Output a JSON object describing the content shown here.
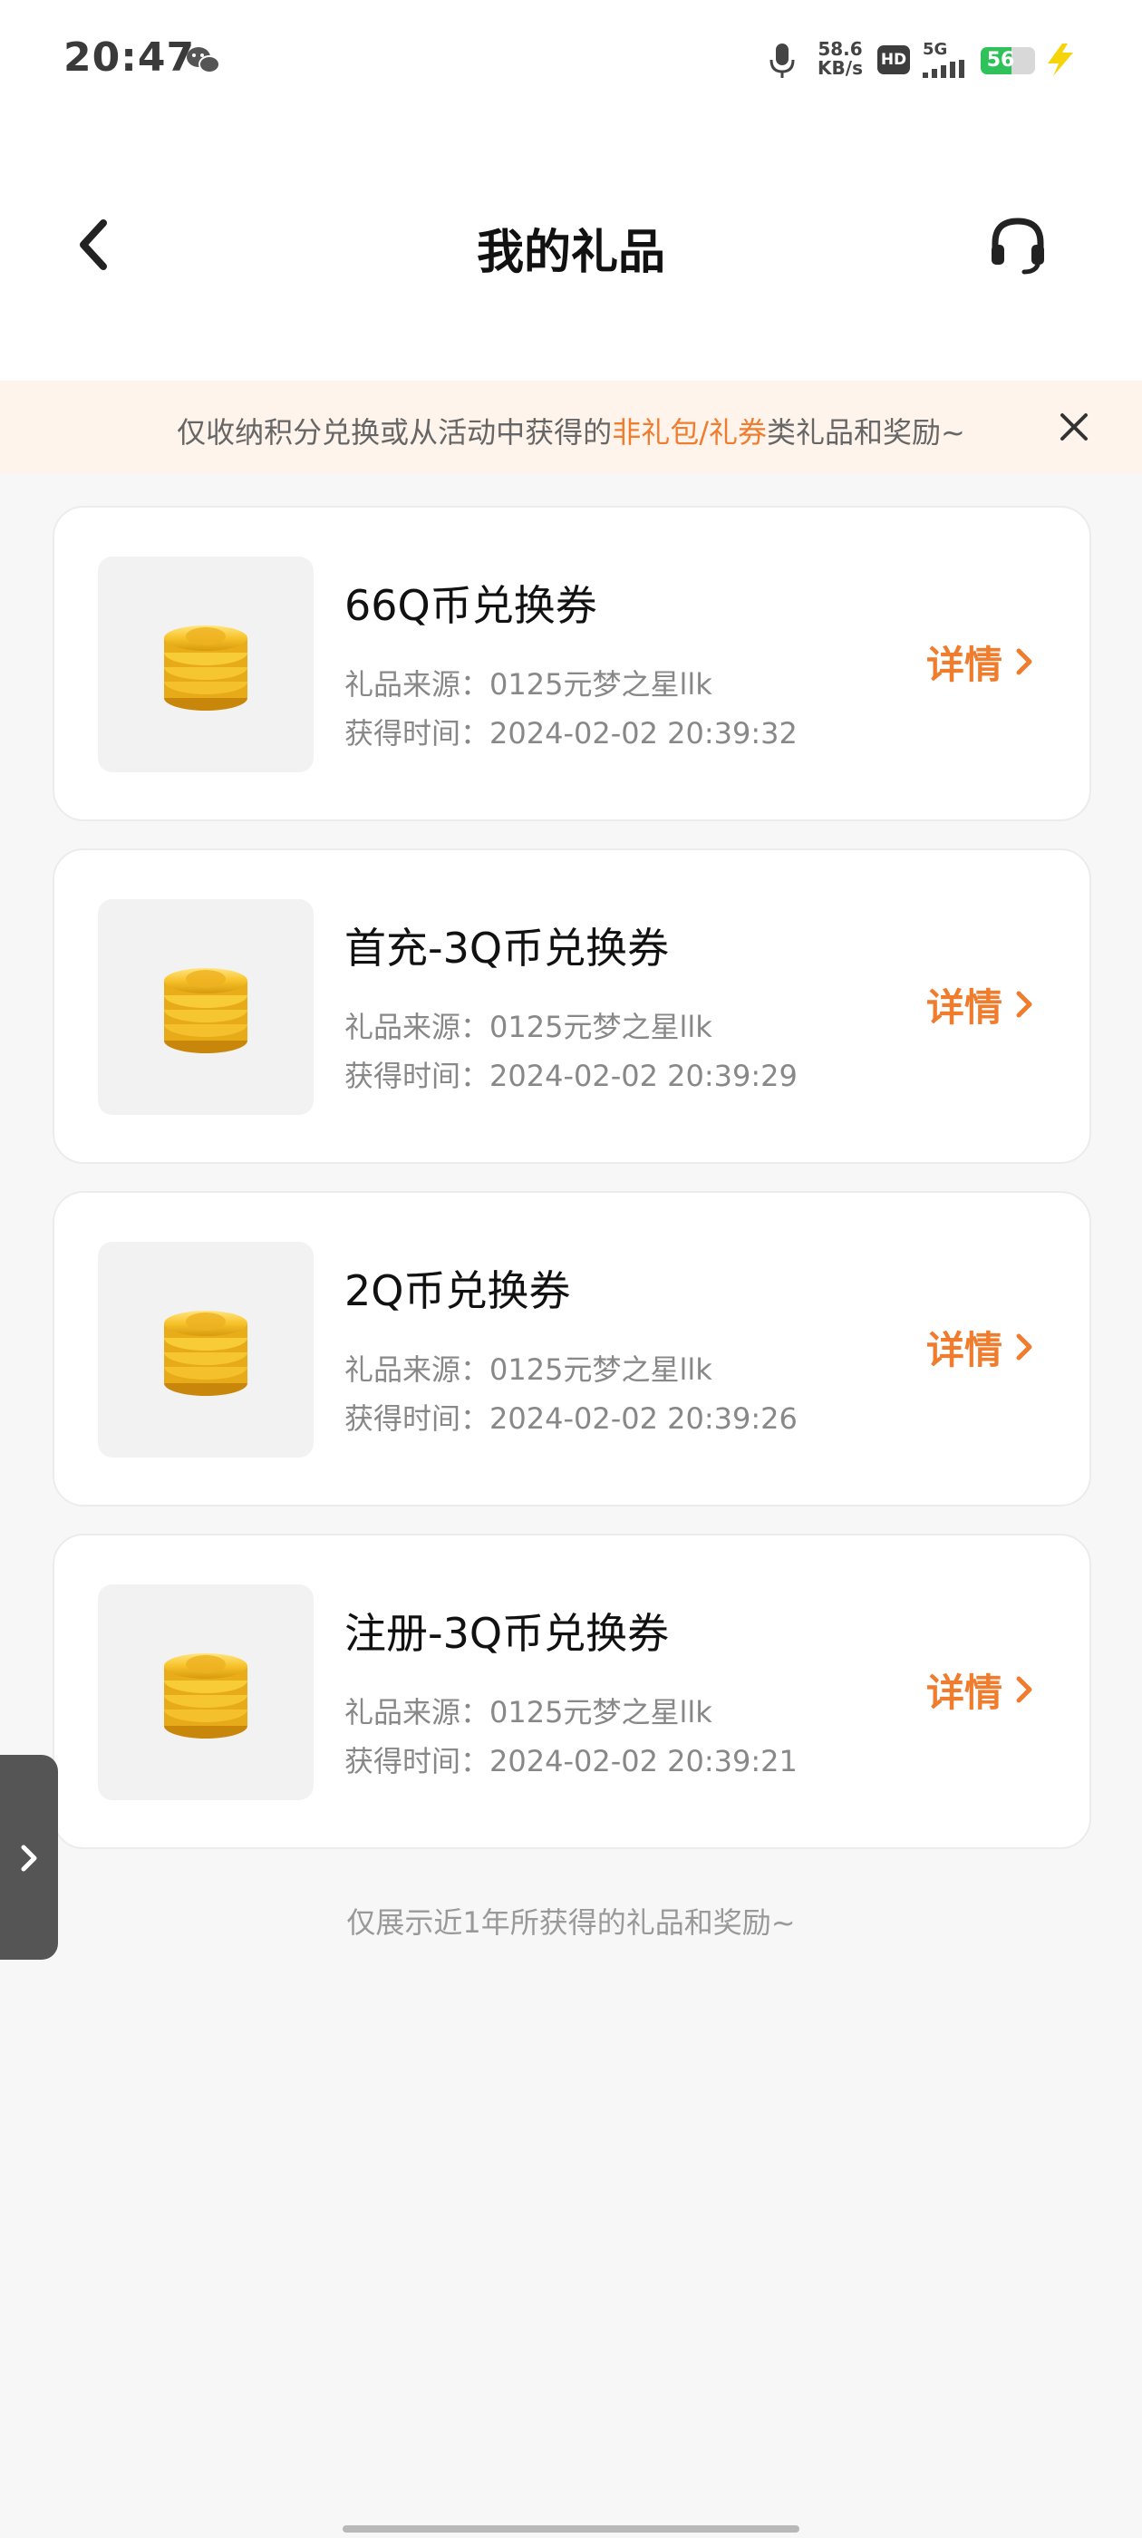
{
  "status_bar": {
    "time": "20:47",
    "net_speed_value": "58.6",
    "net_speed_unit": "KB/s",
    "hd_label": "HD",
    "network_type": "5G",
    "battery_level": "56",
    "battery_color": "#2fc25b"
  },
  "nav": {
    "title": "我的礼品",
    "back_icon": "chevron-left-icon",
    "support_icon": "headset-icon"
  },
  "notice": {
    "text_before": "仅收纳积分兑换或从活动中获得的",
    "highlight": "非礼包/礼券",
    "text_after": "类礼品和奖励~",
    "highlight_color": "#f07c2e"
  },
  "gifts": [
    {
      "name": "66Q币兑换券",
      "source": "礼品来源：0125元梦之星llk",
      "time": "获得时间：2024-02-02 20:39:32",
      "detail_label": "详情"
    },
    {
      "name": "首充-3Q币兑换券",
      "source": "礼品来源：0125元梦之星llk",
      "time": "获得时间：2024-02-02 20:39:29",
      "detail_label": "详情"
    },
    {
      "name": "2Q币兑换券",
      "source": "礼品来源：0125元梦之星llk",
      "time": "获得时间：2024-02-02 20:39:26",
      "detail_label": "详情"
    },
    {
      "name": "注册-3Q币兑换券",
      "source": "礼品来源：0125元梦之星llk",
      "time": "获得时间：2024-02-02 20:39:21",
      "detail_label": "详情"
    }
  ],
  "footer_note": "仅展示近1年所获得的礼品和奖励~",
  "accent_color": "#f07c2e"
}
